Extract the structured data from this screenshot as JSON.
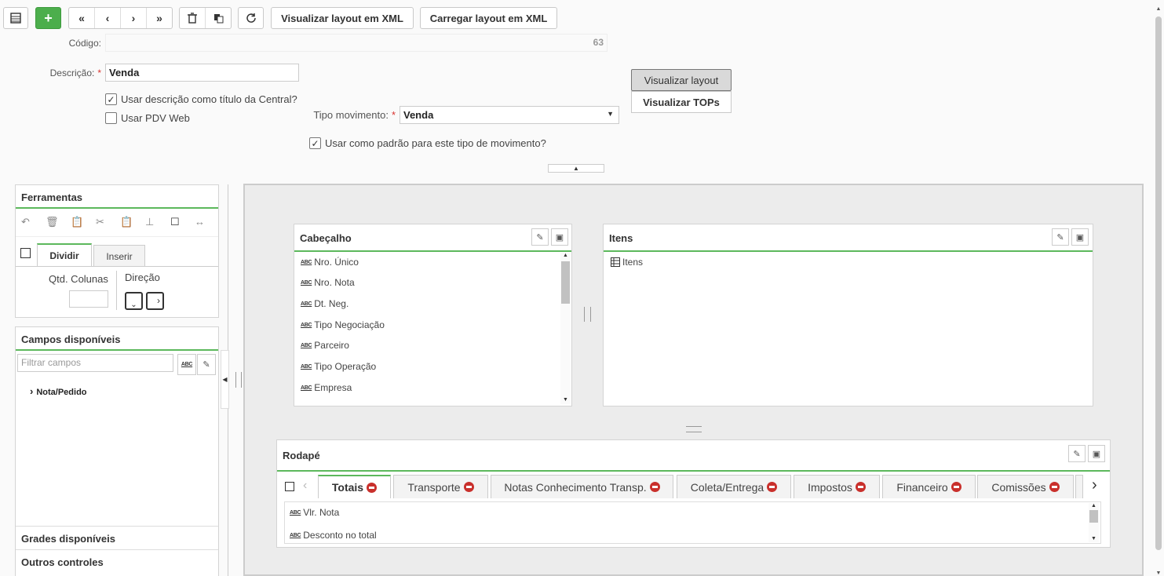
{
  "toolbar": {
    "xml_view": "Visualizar layout em XML",
    "xml_load": "Carregar layout em XML"
  },
  "form": {
    "codigo_label": "Código:",
    "codigo_value": "63",
    "descricao_label": "Descrição:",
    "descricao_value": "Venda",
    "usar_descricao": "Usar descrição como título da Central?",
    "usar_pdv": "Usar PDV Web",
    "tipo_mov_label": "Tipo movimento:",
    "tipo_mov_value": "Venda",
    "usar_padrao": "Usar como padrão para este tipo de movimento?",
    "btn_view_layout": "Visualizar layout",
    "btn_view_tops": "Visualizar TOPs"
  },
  "ferramentas": {
    "title": "Ferramentas",
    "tab_dividir": "Dividir",
    "tab_inserir": "Inserir",
    "qtd_colunas": "Qtd. Colunas",
    "direcao": "Direção"
  },
  "campos": {
    "title": "Campos disponíveis",
    "filter_placeholder": "Filtrar campos",
    "tree_item": "Nota/Pedido"
  },
  "grades": {
    "title": "Grades disponíveis"
  },
  "outros": {
    "title": "Outros controles"
  },
  "cabecalho": {
    "title": "Cabeçalho",
    "fields": [
      "Nro. Único",
      "Nro. Nota",
      "Dt. Neg.",
      "Tipo Negociação",
      "Parceiro",
      "Tipo Operação",
      "Empresa"
    ]
  },
  "itens": {
    "title": "Itens",
    "grid": "Itens"
  },
  "rodape": {
    "title": "Rodapé",
    "tabs": [
      "Totais",
      "Transporte",
      "Notas Conhecimento Transp.",
      "Coleta/Entrega",
      "Impostos",
      "Financeiro",
      "Comissões"
    ],
    "fields": [
      "Vlr. Nota",
      "Desconto no total"
    ]
  },
  "colors": {
    "accent": "#5cb85c",
    "add_button": "#4cae4c",
    "required": "#d9332f"
  }
}
